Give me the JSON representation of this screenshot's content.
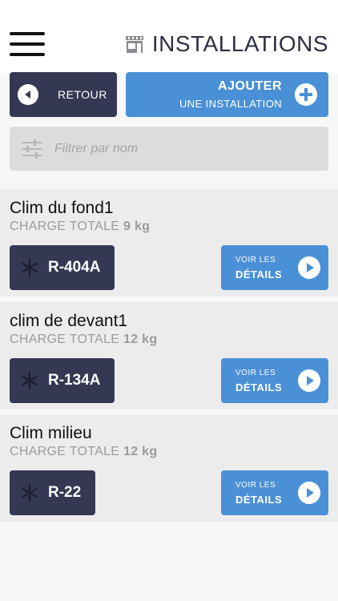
{
  "header": {
    "title": "INSTALLATIONS",
    "title_icon": "store-icon",
    "menu_icon": "hamburger-menu-icon"
  },
  "actions": {
    "back_label": "RETOUR",
    "add_line1": "AJOUTER",
    "add_line2": "UNE INSTALLATION"
  },
  "filter": {
    "placeholder": "Filtrer par nom",
    "value": ""
  },
  "installations": [
    {
      "name": "Clim du fond1",
      "charge_label": "CHARGE TOTALE",
      "charge_value": "9 kg",
      "gas": "R-404A",
      "details_line1": "VOIR LES",
      "details_line2": "DÉTAILS"
    },
    {
      "name": "clim de devant1",
      "charge_label": "CHARGE TOTALE",
      "charge_value": "12 kg",
      "gas": "R-134A",
      "details_line1": "VOIR LES",
      "details_line2": "DÉTAILS"
    },
    {
      "name": "Clim milieu",
      "charge_label": "CHARGE TOTALE",
      "charge_value": "12 kg",
      "gas": "R-22",
      "details_line1": "VOIR LES",
      "details_line2": "DÉTAILS"
    }
  ],
  "colors": {
    "dark": "#353852",
    "accent": "#4a90d6",
    "card_bg": "#ececec",
    "muted_text": "#9b9b9b"
  }
}
